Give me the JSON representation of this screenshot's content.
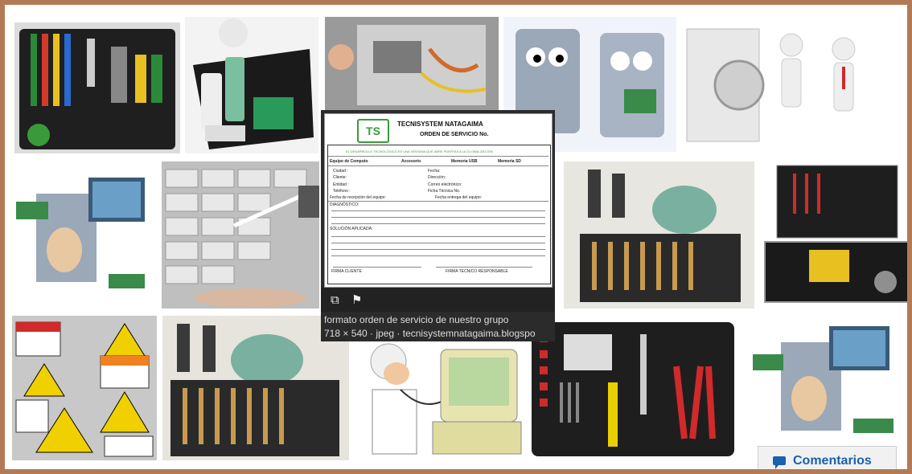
{
  "preview": {
    "doc_title": "TECNISYSTEM NATAGAIMA",
    "doc_subtitle": "ORDEN DE SERVICIO  No.",
    "logo_text": "TS",
    "slogan": "EL DESARROLLO TECNOLÓGICO ES UNA VENTANA QUE ABRE PUERTAS A LA GLOBALIZACIÓN",
    "row_equipo": "Equipo de Computo",
    "row_accesorio": "Accesorio",
    "row_memoria_usb": "Memoria USB",
    "row_memoria_sd": "Memoria SD",
    "field_ciudad": "Ciudad :",
    "field_cliente": "Cliente:",
    "field_entidad": "Entidad :",
    "field_telefono": "Teléfono :",
    "field_fecha": "Fecha:",
    "field_direccion": "Dirección:",
    "field_correo": "Correo electrónico:",
    "field_ficha": "Ficha Técnica No.",
    "field_recepcion": "Fecha de recepción del equipo:",
    "field_entrega": "Fecha entrega del equipo:",
    "diagnostico": "DIAGNÓSTICO:",
    "solucion": "SOLUCIÓN APLICADA:",
    "firma_cliente": "FIRMA   CLIENTE",
    "firma_tecnico": "FIRMA TECNICO RESPONSABLE",
    "caption_title": "formato orden de servicio de nuestro grupo",
    "caption_meta": "718 × 540 · jpeg · tecnisystemnatagaima.blogspo",
    "icons": [
      "related-images-icon",
      "report-flag-icon"
    ]
  },
  "comments": {
    "label": "Comentarios",
    "icon": "speech-bubble-icon"
  },
  "colors": {
    "border": "#b27a55",
    "accent": "#1a5fb0"
  }
}
